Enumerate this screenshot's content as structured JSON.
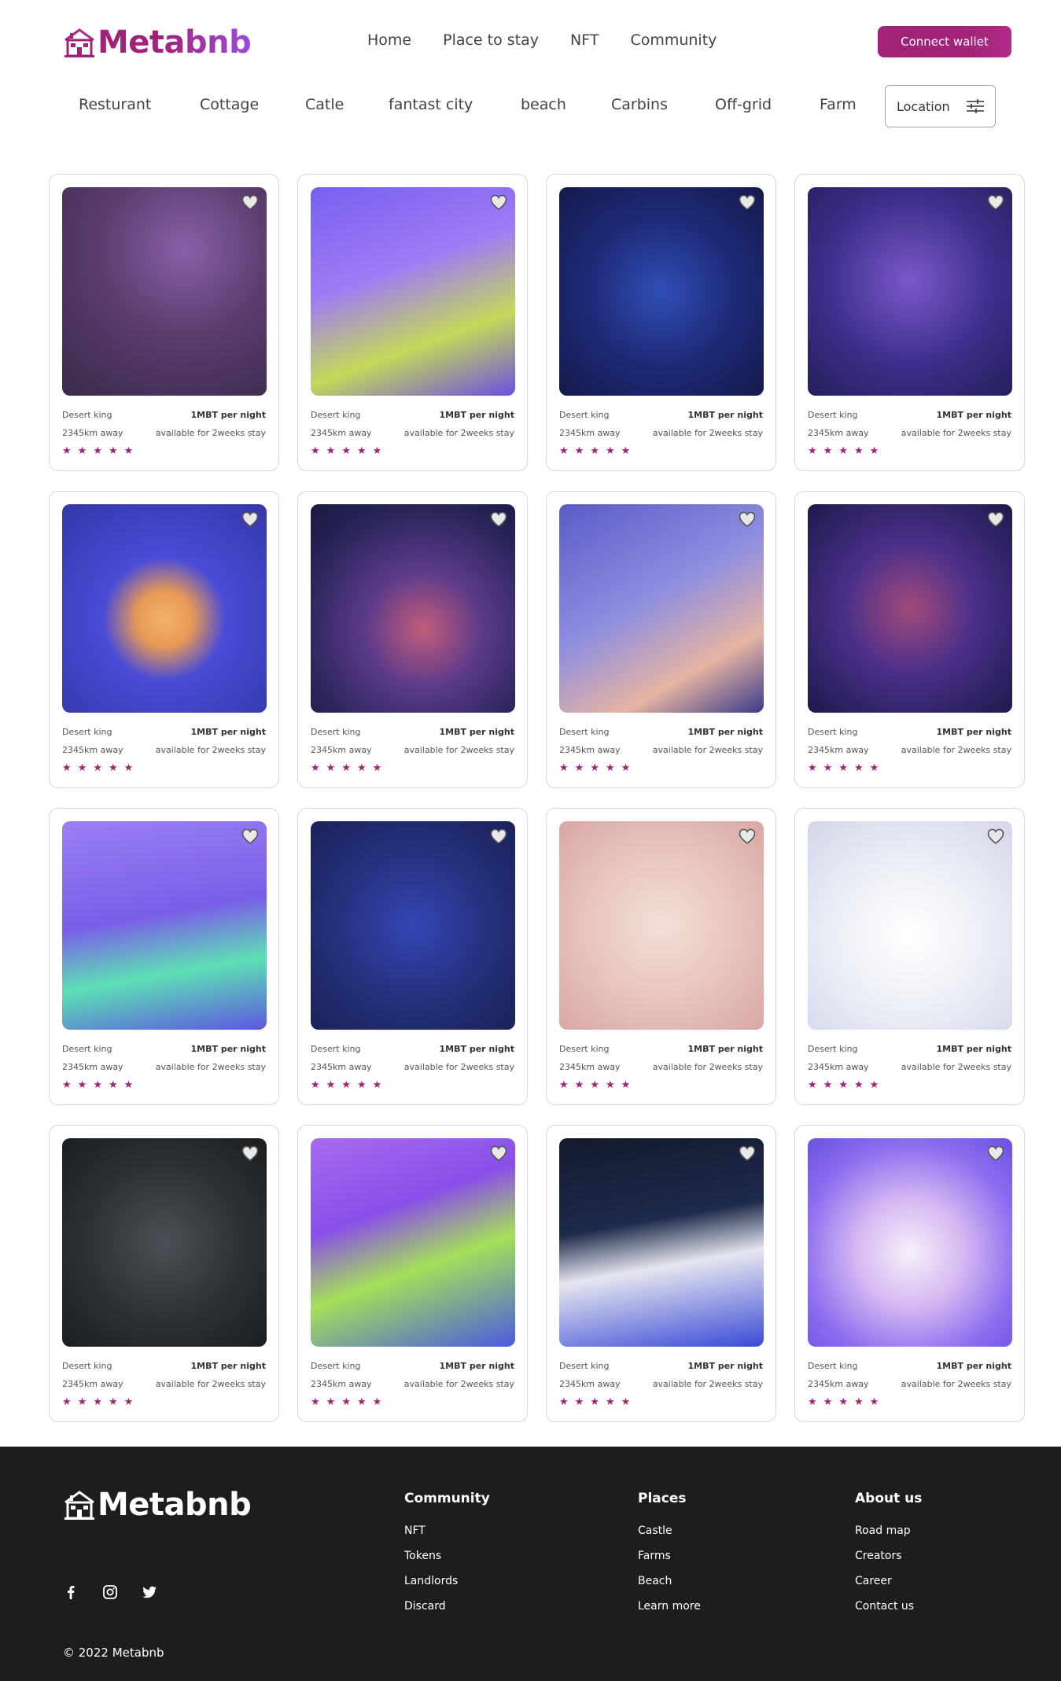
{
  "header": {
    "logo_text": "Metabnb",
    "nav": [
      "Home",
      "Place to stay",
      "NFT",
      "Community"
    ],
    "connect_label": "Connect wallet"
  },
  "filters": {
    "items": [
      "Resturant",
      "Cottage",
      "Catle",
      "fantast city",
      "beach",
      "Carbins",
      "Off-grid",
      "Farm"
    ],
    "location_label": "Location"
  },
  "listings": [
    {
      "name": "Desert king",
      "price": "1MBT per night",
      "distance": "2345km away",
      "availability": "available for 2weeks stay",
      "rating": 5,
      "art": "purple-tower"
    },
    {
      "name": "Desert king",
      "price": "1MBT per night",
      "distance": "2345km away",
      "availability": "available for 2weeks stay",
      "rating": 5,
      "art": "mountain-city"
    },
    {
      "name": "Desert king",
      "price": "1MBT per night",
      "distance": "2345km away",
      "availability": "available for 2weeks stay",
      "rating": 5,
      "art": "floating-island"
    },
    {
      "name": "Desert king",
      "price": "1MBT per night",
      "distance": "2345km away",
      "availability": "available for 2weeks stay",
      "rating": 5,
      "art": "night-castle-town"
    },
    {
      "name": "Desert king",
      "price": "1MBT per night",
      "distance": "2345km away",
      "availability": "available for 2weeks stay",
      "rating": 5,
      "art": "desert-house"
    },
    {
      "name": "Desert king",
      "price": "1MBT per night",
      "distance": "2345km away",
      "availability": "available for 2weeks stay",
      "rating": 5,
      "art": "forest-tower"
    },
    {
      "name": "Desert king",
      "price": "1MBT per night",
      "distance": "2345km away",
      "availability": "available for 2weeks stay",
      "rating": 5,
      "art": "space-base"
    },
    {
      "name": "Desert king",
      "price": "1MBT per night",
      "distance": "2345km away",
      "availability": "available for 2weeks stay",
      "rating": 5,
      "art": "palm-house-night"
    },
    {
      "name": "Desert king",
      "price": "1MBT per night",
      "distance": "2345km away",
      "availability": "available for 2weeks stay",
      "rating": 5,
      "art": "market-stall"
    },
    {
      "name": "Desert king",
      "price": "1MBT per night",
      "distance": "2345km away",
      "availability": "available for 2weeks stay",
      "rating": 5,
      "art": "stone-castle"
    },
    {
      "name": "Desert king",
      "price": "1MBT per night",
      "distance": "2345km away",
      "availability": "available for 2weeks stay",
      "rating": 5,
      "art": "toy-room"
    },
    {
      "name": "Desert king",
      "price": "1MBT per night",
      "distance": "2345km away",
      "availability": "available for 2weeks stay",
      "rating": 5,
      "art": "snow-cottage"
    },
    {
      "name": "Desert king",
      "price": "1MBT per night",
      "distance": "2345km away",
      "availability": "available for 2weeks stay",
      "rating": 5,
      "art": "neon-diner"
    },
    {
      "name": "Desert king",
      "price": "1MBT per night",
      "distance": "2345km away",
      "availability": "available for 2weeks stay",
      "rating": 5,
      "art": "park-bridge"
    },
    {
      "name": "Desert king",
      "price": "1MBT per night",
      "distance": "2345km away",
      "availability": "available for 2weeks stay",
      "rating": 5,
      "art": "modern-villa"
    },
    {
      "name": "Desert king",
      "price": "1MBT per night",
      "distance": "2345km away",
      "availability": "available for 2weeks stay",
      "rating": 5,
      "art": "gingerbread-house"
    }
  ],
  "footer": {
    "logo_text": "Metabnb",
    "socials": [
      "facebook-icon",
      "instagram-icon",
      "twitter-icon"
    ],
    "columns": [
      {
        "title": "Community",
        "links": [
          "NFT",
          "Tokens",
          "Landlords",
          "Discard"
        ]
      },
      {
        "title": "Places",
        "links": [
          "Castle",
          "Farms",
          "Beach",
          "Learn more"
        ]
      },
      {
        "title": "About us",
        "links": [
          "Road map",
          "Creators",
          "Career",
          "Contact us"
        ]
      }
    ],
    "copyright": "© 2022 Metabnb"
  },
  "colors": {
    "brand": "#a02279",
    "footer_bg": "#1d1d1e",
    "accent_purple": "#9e4be0"
  }
}
